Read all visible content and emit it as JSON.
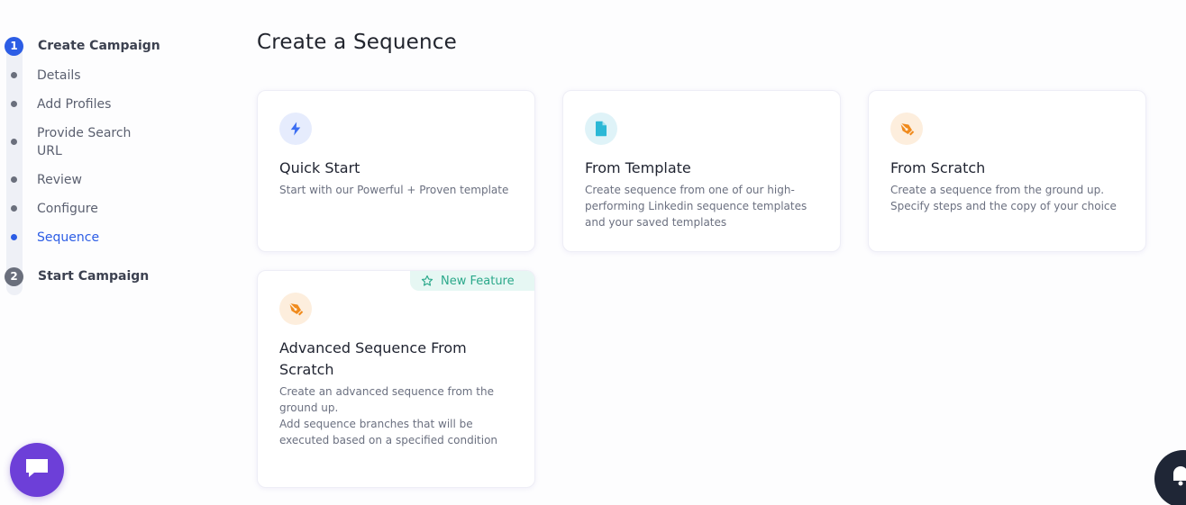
{
  "stepper": {
    "steps": [
      {
        "number": "1",
        "title": "Create Campaign",
        "substeps": [
          "Details",
          "Add Profiles",
          "Provide Search URL",
          "Review",
          "Configure",
          "Sequence"
        ]
      },
      {
        "number": "2",
        "title": "Start Campaign"
      }
    ],
    "active_substep": "Sequence"
  },
  "main": {
    "title": "Create a Sequence",
    "cards": [
      {
        "title": "Quick Start",
        "description": "Start with our Powerful + Proven template",
        "icon": "lightning-icon"
      },
      {
        "title": "From Template",
        "description": "Create sequence from one of our high-performing Linkedin sequence templates and your saved templates",
        "icon": "document-icon"
      },
      {
        "title": "From Scratch",
        "description": "Create a sequence from the ground up. Specify steps and the copy of your choice",
        "icon": "pen-nib-icon"
      },
      {
        "title": "Advanced Sequence From Scratch",
        "description_lines": [
          "Create an advanced sequence from the ground up.",
          "Add sequence branches that will be executed based on a specified condition"
        ],
        "badge": "New Feature",
        "icon": "pen-nib-icon"
      }
    ]
  },
  "widgets": {
    "chat_icon": "chat-bubble-icon",
    "help_icon": "support-icon"
  },
  "colors": {
    "accent": "#2c5de5",
    "badge_text": "#2aa88a",
    "badge_bg": "#e6f7f3",
    "chat_fab": "#6d3fd8"
  }
}
